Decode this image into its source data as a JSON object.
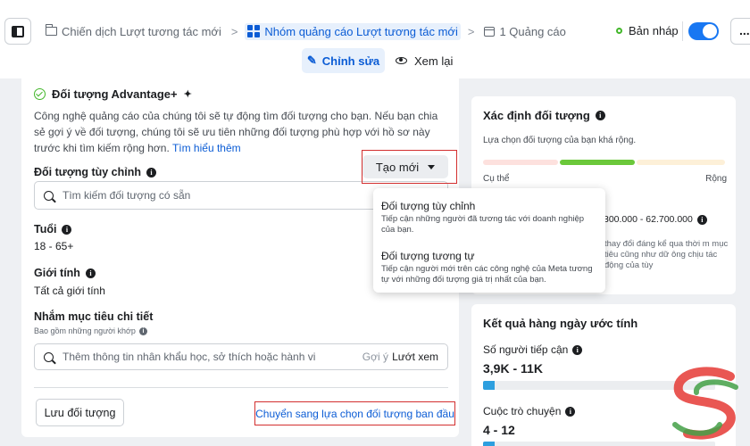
{
  "header": {
    "breadcrumbs": [
      {
        "label": "Chiến dịch Lượt tương tác mới",
        "icon": "folder-icon"
      },
      {
        "label": "Nhóm quảng cáo Lượt tương tác mới",
        "icon": "ad-set-grid-icon",
        "active": true
      },
      {
        "label": "1 Quảng cáo",
        "icon": "ad-icon"
      }
    ],
    "status_label": "Bản nháp",
    "toggle_on": true,
    "edit_label": "Chỉnh sửa",
    "review_label": "Xem lại",
    "more_label": "..."
  },
  "audience": {
    "title": "Đối tượng Advantage+",
    "description": "Công nghệ quảng cáo của chúng tôi sẽ tự động tìm đối tượng cho bạn. Nếu bạn chia sẻ gợi ý về đối tượng, chúng tôi sẽ ưu tiên những đối tượng phù hợp với hồ sơ này trước khi tìm kiếm rộng hơn.",
    "learn_more": "Tìm hiểu thêm",
    "custom_label": "Đối tượng tùy chỉnh",
    "create_new_label": "Tạo mới",
    "search_placeholder": "Tìm kiếm đối tượng có sẵn",
    "age_label": "Tuổi",
    "age_value": "18 - 65+",
    "gender_label": "Giới tính",
    "gender_value": "Tất cả giới tính",
    "detailed_label": "Nhắm mục tiêu chi tiết",
    "detailed_sub": "Bao gồm những người khớp",
    "detailed_placeholder": "Thêm thông tin nhân khẩu học, sở thích hoặc hành vi",
    "suggest_label": "Gợi ý",
    "browse_label": "Lướt xem",
    "save_label": "Lưu đối tượng",
    "switch_label": "Chuyển sang lựa chọn đối tượng ban đầu"
  },
  "dropdown": {
    "items": [
      {
        "title": "Đối tượng tùy chỉnh",
        "desc": "Tiếp cận những người đã tương tác với doanh nghiệp của bạn."
      },
      {
        "title": "Đối tượng tương tự",
        "desc": "Tiếp cận người mới trên các công nghệ của Meta tương tự với những đối tượng giá trị nhất của bạn."
      }
    ]
  },
  "definition": {
    "title": "Xác định đối tượng",
    "subtitle": "Lựa chọn đối tượng của bạn khá rộng.",
    "left_label": "Cụ thể",
    "right_label": "Rộng",
    "reach_value": "300.000 - 62.700.000",
    "note": "thay đổi đáng kể qua thời m mục tiêu cũng như dữ ông chịu tác động của tùy"
  },
  "results": {
    "title": "Kết quả hàng ngày ước tính",
    "reach_label": "Số người tiếp cận",
    "reach_value": "3,9K - 11K",
    "reach_fill": 0.05,
    "conv_label": "Cuộc trò chuyện",
    "conv_value": "4 - 12",
    "conv_fill": 0.05
  },
  "colors": {
    "accent": "#1877f2",
    "link": "#0b5cd5",
    "highlight_box": "#d32f2f",
    "meter_mid": "#6bc83a"
  }
}
